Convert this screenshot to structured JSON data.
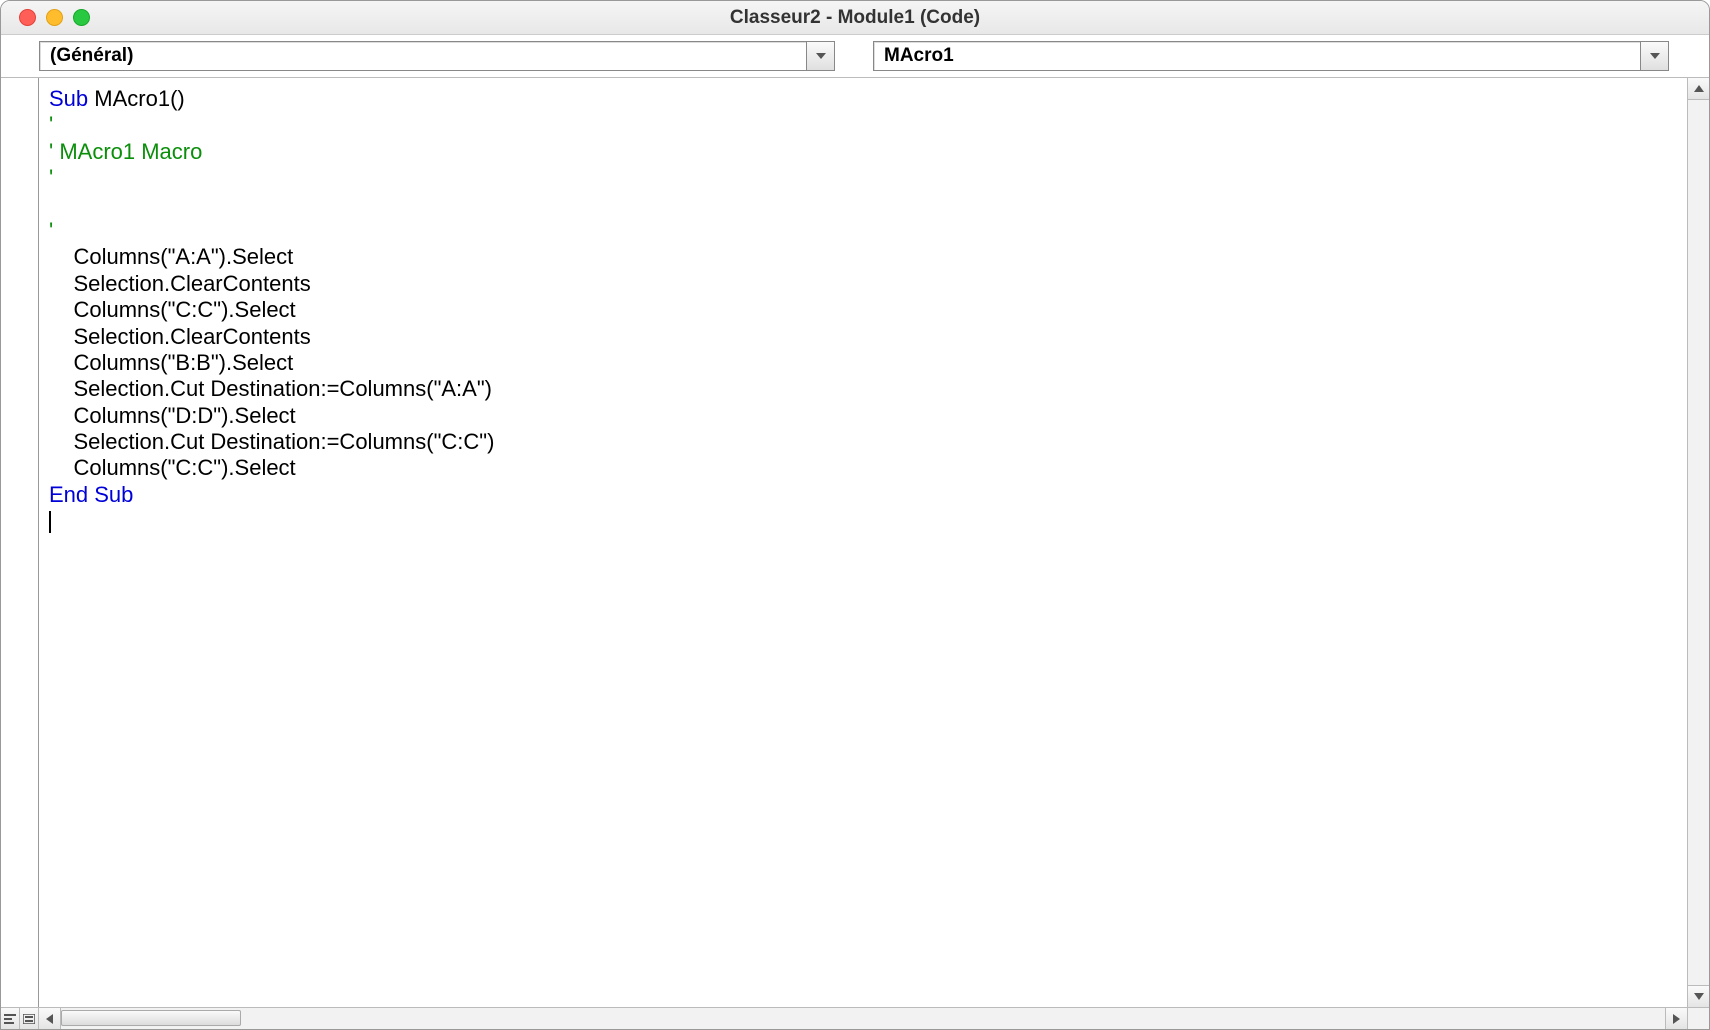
{
  "window": {
    "title": "Classeur2 - Module1 (Code)"
  },
  "dropdowns": {
    "object": "(Général)",
    "procedure": "MAcro1"
  },
  "code": {
    "tokens": [
      [
        {
          "t": "Sub",
          "c": "kw"
        },
        {
          "t": " MAcro1()"
        }
      ],
      [
        {
          "t": "'",
          "c": "comment"
        }
      ],
      [
        {
          "t": "' MAcro1 Macro",
          "c": "comment"
        }
      ],
      [
        {
          "t": "'",
          "c": "comment"
        }
      ],
      [],
      [
        {
          "t": "'",
          "c": "comment"
        }
      ],
      [
        {
          "t": "    Columns(\"A:A\").Select"
        }
      ],
      [
        {
          "t": "    Selection.ClearContents"
        }
      ],
      [
        {
          "t": "    Columns(\"C:C\").Select"
        }
      ],
      [
        {
          "t": "    Selection.ClearContents"
        }
      ],
      [
        {
          "t": "    Columns(\"B:B\").Select"
        }
      ],
      [
        {
          "t": "    Selection.Cut Destination:=Columns(\"A:A\")"
        }
      ],
      [
        {
          "t": "    Columns(\"D:D\").Select"
        }
      ],
      [
        {
          "t": "    Selection.Cut Destination:=Columns(\"C:C\")"
        }
      ],
      [
        {
          "t": "    Columns(\"C:C\").Select"
        }
      ],
      [
        {
          "t": "End Sub",
          "c": "kw"
        }
      ]
    ]
  }
}
